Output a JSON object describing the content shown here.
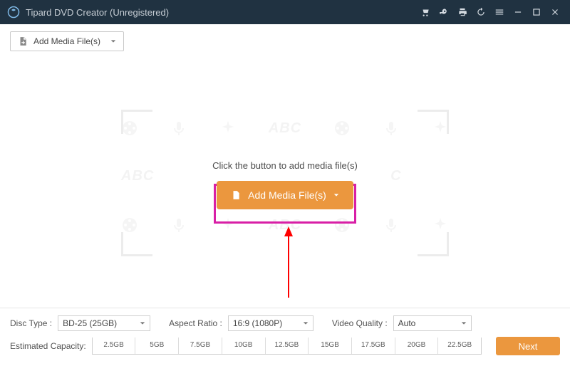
{
  "titlebar": {
    "app_name": "Tipard DVD Creator (Unregistered)"
  },
  "toolbar": {
    "add_media_label": "Add Media File(s)"
  },
  "stage": {
    "hint": "Click the button to add media file(s)",
    "add_media_label": "Add Media File(s)",
    "watermark_abc": "ABC"
  },
  "bottom": {
    "disc_type_label": "Disc Type :",
    "disc_type_value": "BD-25 (25GB)",
    "aspect_label": "Aspect Ratio :",
    "aspect_value": "16:9 (1080P)",
    "quality_label": "Video Quality :",
    "quality_value": "Auto",
    "capacity_label": "Estimated Capacity:",
    "ticks": [
      "2.5GB",
      "5GB",
      "7.5GB",
      "10GB",
      "12.5GB",
      "15GB",
      "17.5GB",
      "20GB",
      "22.5GB"
    ],
    "next_label": "Next"
  }
}
